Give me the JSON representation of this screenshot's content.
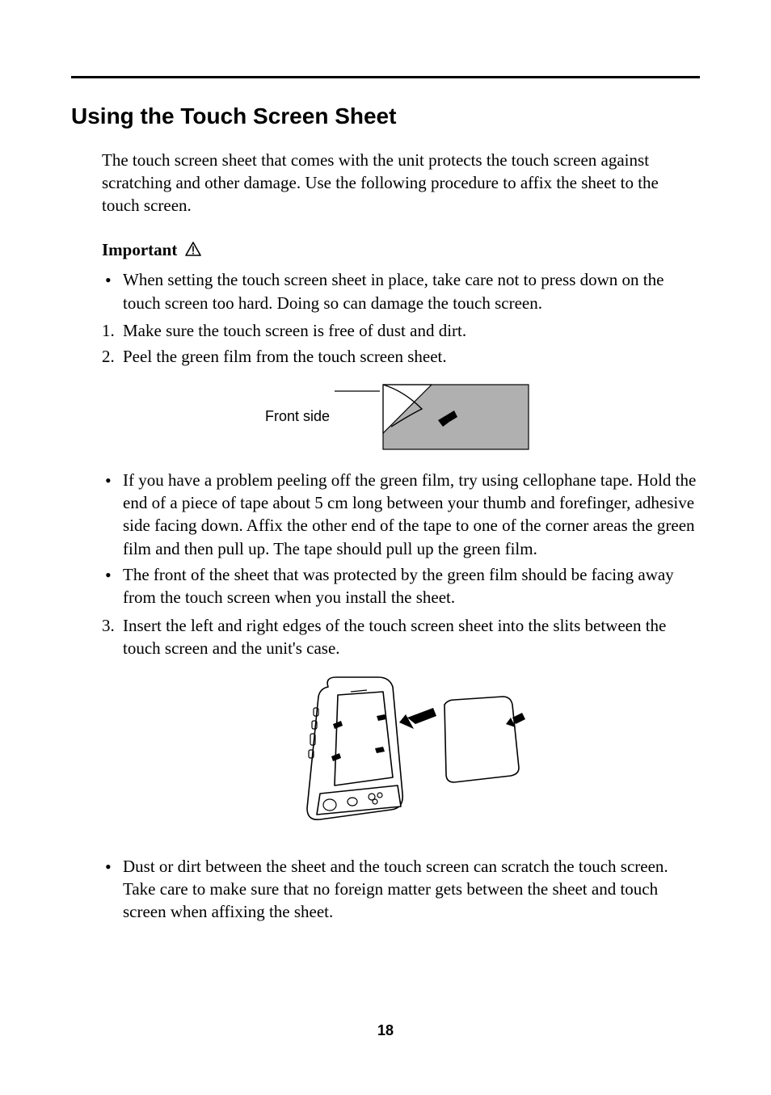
{
  "title": "Using the Touch Screen Sheet",
  "intro": "The touch screen sheet that comes with the unit protects the touch screen against scratching and other damage. Use the following procedure to affix the sheet to the touch screen.",
  "important_label": "Important",
  "bullets_top": [
    "When setting the touch screen sheet in place, take care not to press down on the touch screen too hard. Doing so can damage the touch screen."
  ],
  "steps_a": [
    "Make sure the touch screen is free of dust and dirt.",
    "Peel the green film from the touch screen sheet."
  ],
  "fig1_label": "Front side",
  "bullets_mid": [
    "If you have a problem peeling off the green film, try using cellophane tape. Hold the end of a piece of tape about 5 cm long between your thumb and forefinger, adhesive side facing down. Affix the other end of the tape to one of the corner areas the green film and then pull up. The tape should pull up the green film.",
    "The front of the sheet that was protected by the green film should be facing away from the touch screen when you install the sheet."
  ],
  "steps_b": [
    "Insert the left and right edges of the touch screen sheet into the slits between the touch screen and the unit's case."
  ],
  "bullets_bottom": [
    "Dust or dirt between the sheet and the touch screen can scratch the touch screen. Take care to make sure that no foreign matter gets between the sheet and touch screen when affixing the sheet."
  ],
  "page_number": "18"
}
